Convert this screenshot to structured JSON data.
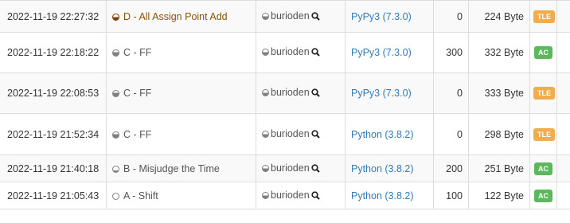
{
  "submissions": [
    {
      "time": "2022-11-19 22:27:32",
      "task": "D - All Assign Point Add",
      "user": "burioden",
      "lang": "PyPy3 (7.3.0)",
      "score": "0",
      "size": "224 Byte",
      "status": "TLE"
    },
    {
      "time": "2022-11-19 22:18:22",
      "task": "C - FF",
      "user": "burioden",
      "lang": "PyPy3 (7.3.0)",
      "score": "300",
      "size": "332 Byte",
      "status": "AC"
    },
    {
      "time": "2022-11-19 22:08:53",
      "task": "C - FF",
      "user": "burioden",
      "lang": "PyPy3 (7.3.0)",
      "score": "0",
      "size": "333 Byte",
      "status": "TLE"
    },
    {
      "time": "2022-11-19 21:52:34",
      "task": "C - FF",
      "user": "burioden",
      "lang": "Python (3.8.2)",
      "score": "0",
      "size": "298 Byte",
      "status": "TLE"
    },
    {
      "time": "2022-11-19 21:40:18",
      "task": "B - Misjudge the Time",
      "user": "burioden",
      "lang": "Python (3.8.2)",
      "score": "200",
      "size": "251 Byte",
      "status": "AC"
    },
    {
      "time": "2022-11-19 21:05:43",
      "task": "A - Shift",
      "user": "burioden",
      "lang": "Python (3.8.2)",
      "score": "100",
      "size": "122 Byte",
      "status": "AC"
    }
  ],
  "colors": {
    "ac": "#5cb85c",
    "tle": "#f0ad4e",
    "link": "#337ab7",
    "task_brown": "#8a5300"
  },
  "icons": {
    "difficulty": "difficulty-circle-icon",
    "search": "search-icon"
  }
}
